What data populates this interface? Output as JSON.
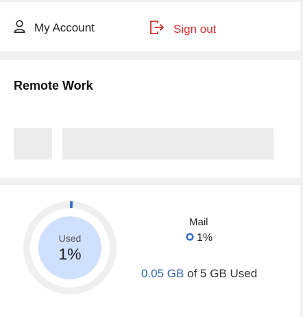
{
  "account": {
    "my_account_label": "My Account",
    "sign_out_label": "Sign out",
    "my_account_icon": "user-icon",
    "sign_out_icon": "sign-out-icon",
    "sign_out_color": "#d82b2b"
  },
  "remote_work": {
    "title": "Remote Work"
  },
  "storage": {
    "used_label": "Used",
    "used_percent": "1%",
    "used_fraction": 0.01,
    "ring_track_color": "#efefef",
    "ring_fill_color": "#3a6fcf",
    "center_color": "#cfe0ff",
    "mail_label": "Mail",
    "mail_percent": "1%",
    "used_amount": "0.05 GB",
    "total_text": "of 5 GB Used"
  }
}
